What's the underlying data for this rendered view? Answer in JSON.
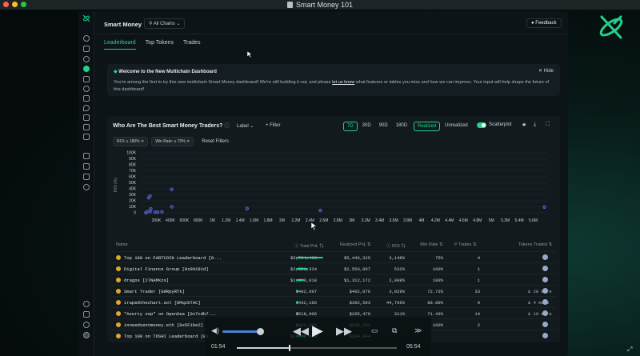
{
  "window": {
    "title": "Smart Money 101"
  },
  "header": {
    "title": "Smart Money",
    "chain_selector": "All Chains",
    "feedback_label": "Feedback"
  },
  "tabs": [
    {
      "label": "Leaderboard",
      "active": true
    },
    {
      "label": "Top Tokens",
      "active": false
    },
    {
      "label": "Trades",
      "active": false
    }
  ],
  "banner": {
    "title": "Welcome to the New Multichain Dashboard",
    "hide_label": "Hide",
    "text_before": "You're among the first to try this new multichain Smart Money dashboard! We're still building it out, and please ",
    "link": "let us know",
    "text_after": " what features or tables you miss and how we can improve. Your input will help shape the future of this dashboard!"
  },
  "panel": {
    "title": "Who Are The Best Smart Money Traders?",
    "label_dropdown": "Label",
    "filter_label": "+ Filter",
    "periods": [
      "7D",
      "30D",
      "90D",
      "180D"
    ],
    "active_period": "7D",
    "realized": "Realized",
    "unrealized": "Unrealized",
    "scatterplot": "Scatterplot",
    "filter_chips": [
      "ROI: ≥ 180%",
      "Win Rate: ≥ 70%"
    ],
    "reset_filters": "Reset Filters"
  },
  "chart_data": {
    "type": "scatter",
    "xlabel": "",
    "ylabel": "ROI (%)",
    "x_ticks": [
      "200K",
      "400K",
      "600K",
      "800K",
      "1M",
      "1.2M",
      "1.4M",
      "1.6M",
      "1.8M",
      "2M",
      "2.2M",
      "2.4M",
      "2.6M",
      "2.8M",
      "3M",
      "3.2M",
      "3.4M",
      "3.6M",
      "3.8M",
      "4M",
      "4.2M",
      "4.4M",
      "4.6M",
      "4.8M",
      "5M",
      "5.2M",
      "5.4M",
      "5.6M"
    ],
    "y_ticks": [
      "100K",
      "90K",
      "80K",
      "70K",
      "60K",
      "50K",
      "40K",
      "30K",
      "20K",
      "10K",
      "0"
    ],
    "points": [
      {
        "x": 50000,
        "y": 0
      },
      {
        "x": 70000,
        "y": 2000
      },
      {
        "x": 110000,
        "y": 2000
      },
      {
        "x": 120000,
        "y": 6500
      },
      {
        "x": 180000,
        "y": 1000
      },
      {
        "x": 220000,
        "y": 1000
      },
      {
        "x": 280000,
        "y": 1500
      },
      {
        "x": 90000,
        "y": 25000
      },
      {
        "x": 110000,
        "y": 28000
      },
      {
        "x": 420000,
        "y": 39000
      },
      {
        "x": 420000,
        "y": 10000
      },
      {
        "x": 1500000,
        "y": 7000
      },
      {
        "x": 2550000,
        "y": 4000
      },
      {
        "x": 5760000,
        "y": 9500
      }
    ],
    "xlim": [
      0,
      5800000
    ],
    "ylim": [
      0,
      100000
    ]
  },
  "table": {
    "columns": [
      "Name",
      "Total PnL",
      "Realized PnL",
      "ROI",
      "Win Rate",
      "# Trades",
      "Tokens Traded"
    ],
    "rows": [
      {
        "name": "Top 100 on FARTCOIN Leaderboard [0...",
        "total": "$5,764,493",
        "realized": "$5,446,325",
        "roi": "3,148%",
        "win": "75%",
        "trades": "4",
        "tokens": "",
        "bar": 1.0
      },
      {
        "name": "Digital Finance Group [0x99181d]",
        "total": "$2,551,334",
        "realized": "$2,550,897",
        "roi": "532%",
        "win": "100%",
        "trades": "1",
        "tokens": "",
        "bar": 0.45
      },
      {
        "name": "dragos [27NAMXzs]",
        "total": "$1,640,018",
        "realized": "$1,312,172",
        "roi": "2,098%",
        "win": "100%",
        "trades": "1",
        "tokens": "",
        "bar": 0.3
      },
      {
        "name": "Smart Trader [G9RpyRTk]",
        "total": "$402,097",
        "realized": "$402,076",
        "roi": "3,029%",
        "win": "72.73%",
        "trades": "33",
        "tokens": "& 28 more",
        "bar": 0.08
      },
      {
        "name": "irapedthechart.sol [DMq1bTAC]",
        "total": "$432,166",
        "realized": "$392,503",
        "roi": "44,766%",
        "win": "88.89%",
        "trades": "9",
        "tokens": "& 4 more",
        "bar": 0.08
      },
      {
        "name": "\"Azerty oop\" on OpenSea [0x7cdb7...",
        "total": "$518,906",
        "realized": "$265,470",
        "roi": "311%",
        "win": "71.43%",
        "trades": "14",
        "tokens": "& 10 more",
        "bar": 0.09
      },
      {
        "name": "inneedsentmoney.eth [0x5F1be2]",
        "total": "$303,442",
        "realized": "$236,201",
        "roi": "",
        "win": "100%",
        "trades": "2",
        "tokens": "",
        "bar": 0.05
      },
      {
        "name": "Top 100 on TOSHI Leaderboard [0x...",
        "total": "$2,002,449",
        "realized": "$204,044",
        "roi": "",
        "win": "",
        "trades": "",
        "tokens": "",
        "bar": 0.35
      }
    ]
  },
  "media": {
    "elapsed": "01:54",
    "remaining": "05:54"
  }
}
